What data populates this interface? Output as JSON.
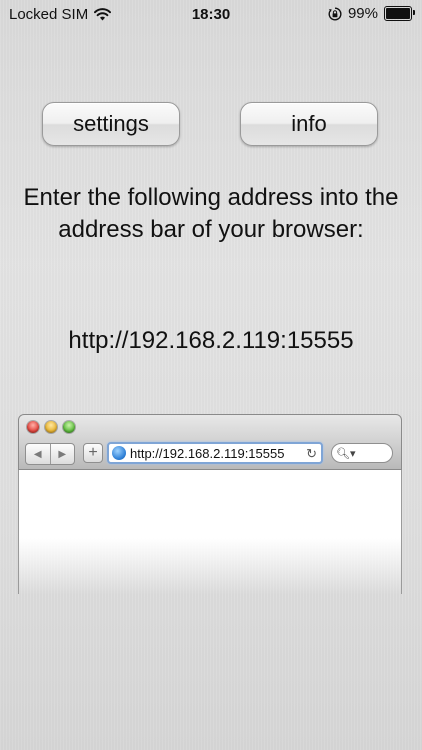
{
  "status_bar": {
    "carrier": "Locked SIM",
    "time": "18:30",
    "battery_percent": "99%",
    "battery_level": 0.99,
    "icons": [
      "wifi-icon",
      "rotation-lock-icon",
      "battery-icon"
    ]
  },
  "buttons": {
    "settings_label": "settings",
    "info_label": "info"
  },
  "instructions": "Enter the following address into the address bar of your browser:",
  "server_address": "http://192.168.2.119:15555",
  "browser_illustration": {
    "url": "http://192.168.2.119:15555",
    "back_glyph": "◀",
    "forward_glyph": "▶",
    "add_glyph": "+",
    "reload_glyph": "↻",
    "search_glyph": "🔍︎▾"
  },
  "colors": {
    "url_focus_ring": "#7fa5d6",
    "text": "#111111"
  }
}
